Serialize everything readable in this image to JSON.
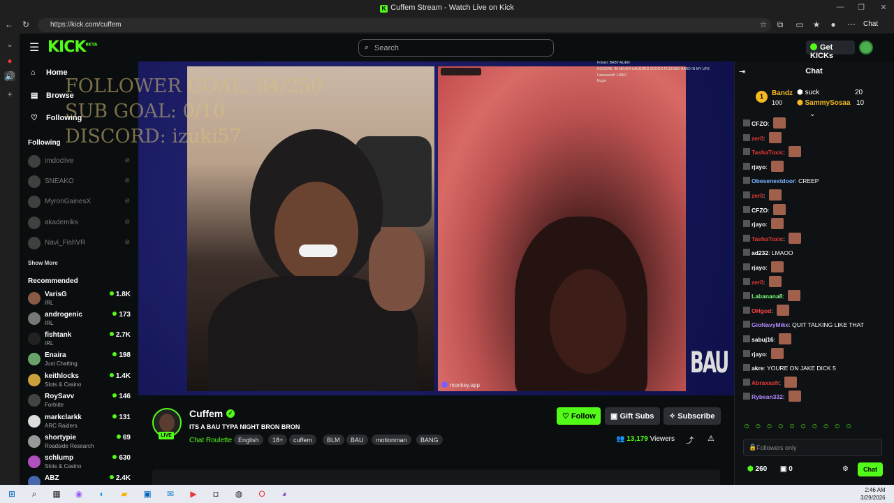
{
  "browser": {
    "window_title": "Cuffem Stream - Watch Live on Kick",
    "url": "https://kick.com/cuffem",
    "profile_label": "Chat"
  },
  "header": {
    "logo": "KICK",
    "logo_badge": "BETA",
    "search_placeholder": "Search",
    "get_kicks_label": "Get KICKs"
  },
  "sidebar": {
    "nav": [
      {
        "label": "Home",
        "icon": "home-icon"
      },
      {
        "label": "Browse",
        "icon": "browse-icon"
      },
      {
        "label": "Following",
        "icon": "heart-icon"
      }
    ],
    "following_title": "Following",
    "following": [
      {
        "name": "imdoclive"
      },
      {
        "name": "SNEAKO"
      },
      {
        "name": "MyronGainesX"
      },
      {
        "name": "akademiks"
      },
      {
        "name": "Navi_FishVR"
      }
    ],
    "show_more": "Show More",
    "recommended_title": "Recommended",
    "recommended": [
      {
        "name": "VarisG",
        "category": "IRL",
        "viewers": "1.8K",
        "color": "#8a5a44"
      },
      {
        "name": "androgenic",
        "category": "IRL",
        "viewers": "173",
        "color": "#777777"
      },
      {
        "name": "fishtank",
        "category": "IRL",
        "viewers": "2.7K",
        "color": "#222222"
      },
      {
        "name": "Enaira",
        "category": "Just Chatting",
        "viewers": "198",
        "color": "#6aa36a"
      },
      {
        "name": "keithlocks",
        "category": "Slots & Casino",
        "viewers": "1.4K",
        "color": "#c9a03b"
      },
      {
        "name": "RoySavv",
        "category": "Fortnite",
        "viewers": "146",
        "color": "#444444"
      },
      {
        "name": "markclarkk",
        "category": "ARC Raiders",
        "viewers": "131",
        "color": "#dddddd"
      },
      {
        "name": "shortypie",
        "category": "Roadside Research",
        "viewers": "69",
        "color": "#999999"
      },
      {
        "name": "schlump",
        "category": "Slots & Casino",
        "viewers": "630",
        "color": "#b04fc0"
      },
      {
        "name": "ABZ",
        "category": "",
        "viewers": "2.4K",
        "color": "#4466aa"
      }
    ]
  },
  "player": {
    "overlay_lines": [
      "FOLLOWER GOAL: 84/250",
      "SUB GOAL: 0/10",
      "DISCORD: izuki57"
    ],
    "watermark": "BAU",
    "source_label": "monkey.app",
    "overlay_chat": [
      "Folsen: BABY ALIEN",
      "KONORE: IM NEVER LAUGHED SOOOO FUCKING HARD IN MY LIFE",
      "Labanana8: LMAO",
      "Bugsi"
    ]
  },
  "channel": {
    "name": "Cuffem",
    "live_label": "LIVE",
    "title": "ITS A BAU TYPA NIGHT BRON BRON",
    "category": "Chat Roulette",
    "tags": [
      "English",
      "18+",
      "cuffem",
      "BLM",
      "BAU",
      "motionman",
      "BANG"
    ],
    "follow_label": "Follow",
    "gift_label": "Gift Subs",
    "subscribe_label": "Subscribe",
    "viewers": "13,179",
    "viewers_suffix": "Viewers"
  },
  "chat": {
    "title": "Chat",
    "leaderboard": {
      "rank": "1",
      "first_name": "Bandz",
      "first_value": "100",
      "second_name": "suck",
      "second_value": "20",
      "third_name": "SammySosaa",
      "third_value": "10"
    },
    "messages": [
      {
        "user": "CFZO",
        "color": "#ffffff",
        "text": "",
        "emote": true
      },
      {
        "user": "zer0",
        "color": "#e53935",
        "text": "",
        "emote": true
      },
      {
        "user": "TashaToxic",
        "color": "#e53935",
        "text": "",
        "emote": true
      },
      {
        "user": "rjayo",
        "color": "#ffffff",
        "text": "",
        "emote": true
      },
      {
        "user": "Obesenextdoor",
        "color": "#7cb5ff",
        "text": "CREEP",
        "emote": false
      },
      {
        "user": "zer0",
        "color": "#e53935",
        "text": "",
        "emote": true
      },
      {
        "user": "CFZO",
        "color": "#ffffff",
        "text": "",
        "emote": true
      },
      {
        "user": "rjayo",
        "color": "#ffffff",
        "text": "",
        "emote": true
      },
      {
        "user": "TashaToxic",
        "color": "#e53935",
        "text": "",
        "emote": true
      },
      {
        "user": "ad232",
        "color": "#ffffff",
        "text": "LMAOO",
        "emote": false
      },
      {
        "user": "rjayo",
        "color": "#ffffff",
        "text": "",
        "emote": true
      },
      {
        "user": "zer0",
        "color": "#e53935",
        "text": "",
        "emote": true
      },
      {
        "user": "Labanana8",
        "color": "#7cfc7c",
        "text": "",
        "emote": true
      },
      {
        "user": "OHgod",
        "color": "#ff4444",
        "text": "",
        "emote": true
      },
      {
        "user": "GioNavyMike",
        "color": "#b388ff",
        "text": "QUIT TALKING LIKE THAT",
        "emote": false
      },
      {
        "user": "sabuj16",
        "color": "#ffffff",
        "text": "",
        "emote": true
      },
      {
        "user": "rjayo",
        "color": "#ffffff",
        "text": "",
        "emote": true
      },
      {
        "user": "akre",
        "color": "#ffffff",
        "text": "YOURE ON JAKE DICK 5",
        "emote": false
      },
      {
        "user": "Abraxasfr",
        "color": "#e53935",
        "text": "",
        "emote": true
      },
      {
        "user": "Rybean332",
        "color": "#b388ff",
        "text": "",
        "emote": true
      }
    ],
    "input_placeholder": "Followers only",
    "points": "260",
    "points2": "0",
    "send_label": "Chat"
  },
  "taskbar": {
    "time": "2:46 AM",
    "date": "3/29/2026"
  }
}
